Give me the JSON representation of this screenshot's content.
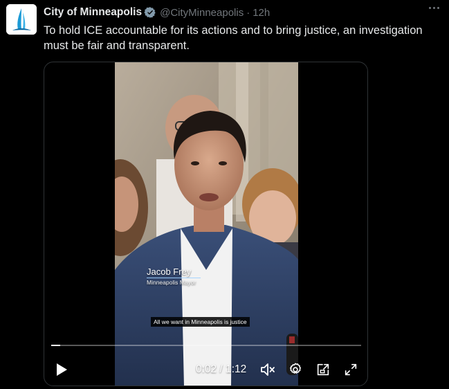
{
  "author": {
    "name": "City of Minneapolis",
    "handle": "@CityMinneapolis",
    "separator": "·",
    "time": "12h",
    "verified_color": "#829aab"
  },
  "tweet": {
    "text": "To hold ICE accountable for its actions and to bring justice, an investigation must be fair and transparent."
  },
  "video": {
    "lower_third_name": "Jacob Frey",
    "lower_third_title": "Minneapolis Mayor",
    "caption": "All we want in Minneapolis is justice",
    "current_time": "0:02",
    "duration": "1:12",
    "timecode": "0:02 / 1:12",
    "progress_fraction": 0.028,
    "muted": true
  },
  "colors": {
    "background": "#000000",
    "text_primary": "#e7e9ea",
    "text_secondary": "#71767b",
    "border": "#2f3336",
    "logo_blue": "#1b9ad6"
  },
  "icons": {
    "play": "play-icon",
    "mute": "speaker-muted-icon",
    "settings": "gear-icon",
    "pip": "picture-in-picture-icon",
    "fullscreen": "expand-icon",
    "more": "more-horizontal-icon",
    "verified": "verified-badge-icon"
  }
}
